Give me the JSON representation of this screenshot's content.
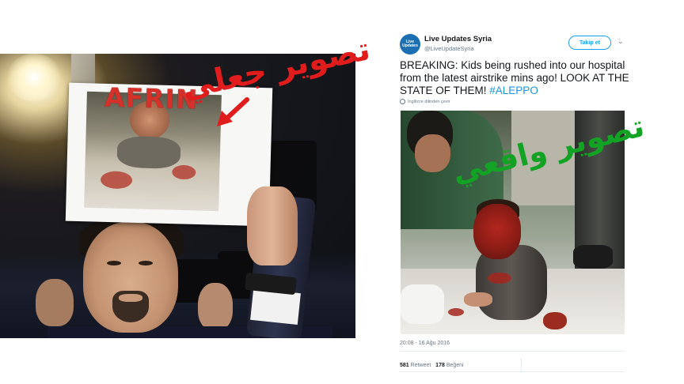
{
  "left_panel": {
    "sign_text": "AFRIN",
    "overlay_label": "تصوير جعلي",
    "overlay_color": "#e01c1c"
  },
  "tweet": {
    "avatar_text": "Live Updates",
    "account_name": "Live Updates Syria",
    "account_handle": "@LiveUpdateSyria",
    "follow_button": "Takip et",
    "text": "BREAKING: Kids being rushed into our hospital from the latest airstrike mins ago! LOOK AT THE STATE OF THEM!",
    "hashtag": "#ALEPPO",
    "translate_link": "İngilizce dilinden çevir",
    "timestamp": "20:08 - 16 Ağu 2016",
    "retweet_count": "581",
    "retweet_label": "Retweet",
    "like_count": "178",
    "like_label": "Beğeni",
    "link_color": "#1b95e0"
  },
  "right_overlay": {
    "label": "تصوير واقعي",
    "color": "#13a324"
  }
}
